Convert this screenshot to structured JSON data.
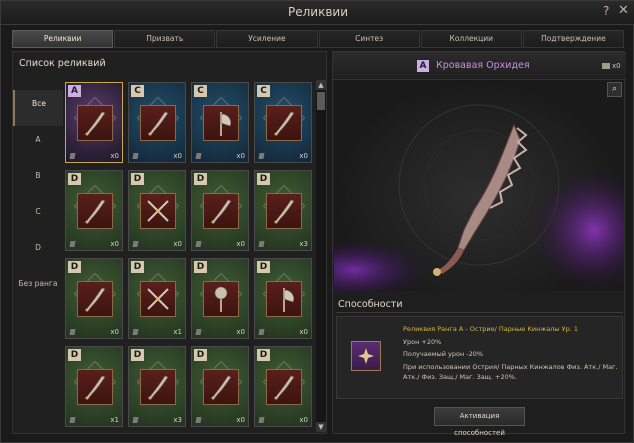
{
  "window": {
    "title": "Реликвии",
    "help": "?",
    "close": "✕"
  },
  "tabs": [
    "Реликвии",
    "Призвать",
    "Усиление",
    "Синтез",
    "Коллекции",
    "Подтверждение"
  ],
  "left": {
    "list_title": "Список реликвий",
    "ranks": [
      "Все",
      "A",
      "B",
      "C",
      "D",
      "Без ранга"
    ],
    "items": [
      {
        "rank": "A",
        "count": "x0",
        "icon": "curved-dagger-icon",
        "bg": "A"
      },
      {
        "rank": "C",
        "count": "x0",
        "icon": "golden-scythe-icon",
        "bg": "C"
      },
      {
        "rank": "C",
        "count": "x0",
        "icon": "axe-icon",
        "bg": "C"
      },
      {
        "rank": "C",
        "count": "x0",
        "icon": "golden-blade-icon",
        "bg": "C"
      },
      {
        "rank": "D",
        "count": "x0",
        "icon": "dagger-icon",
        "bg": "D"
      },
      {
        "rank": "D",
        "count": "x0",
        "icon": "twin-blades-icon",
        "bg": "D"
      },
      {
        "rank": "D",
        "count": "x0",
        "icon": "green-sword-icon",
        "bg": "D"
      },
      {
        "rank": "D",
        "count": "x3",
        "icon": "short-sword-icon",
        "bg": "D"
      },
      {
        "rank": "D",
        "count": "x0",
        "icon": "sword-icon",
        "bg": "D"
      },
      {
        "rank": "D",
        "count": "x1",
        "icon": "crossed-swords-icon",
        "bg": "D"
      },
      {
        "rank": "D",
        "count": "x0",
        "icon": "mace-icon",
        "bg": "D"
      },
      {
        "rank": "D",
        "count": "x0",
        "icon": "battle-axe-icon",
        "bg": "D"
      },
      {
        "rank": "D",
        "count": "x1",
        "icon": "horn-icon",
        "bg": "D"
      },
      {
        "rank": "D",
        "count": "x3",
        "icon": "bow-icon",
        "bg": "D"
      },
      {
        "rank": "D",
        "count": "x0",
        "icon": "claw-icon",
        "bg": "D"
      },
      {
        "rank": "D",
        "count": "x0",
        "icon": "spear-icon",
        "bg": "D"
      }
    ]
  },
  "right": {
    "rank": "A",
    "name": "Кровавая Орхидея",
    "count": "x0",
    "abilities_title": "Способности",
    "ability_lines": [
      "Реликвия Ранга A - Острие/ Парные Кинжалы Ур. 1",
      "Урон +20%",
      "Получаемый урон -20%",
      "При использовании Острия/ Парных Кинжалов Физ. Атк./ Маг.",
      "Атк./ Физ. Защ./ Маг. Защ. +20%."
    ],
    "activate_label": "Активация способностей"
  },
  "colors": {
    "rank_a": "#c9b0e0",
    "title_purple": "#c890e0",
    "ability_gold": "#d4b840",
    "selected_border": "#c7a851"
  }
}
